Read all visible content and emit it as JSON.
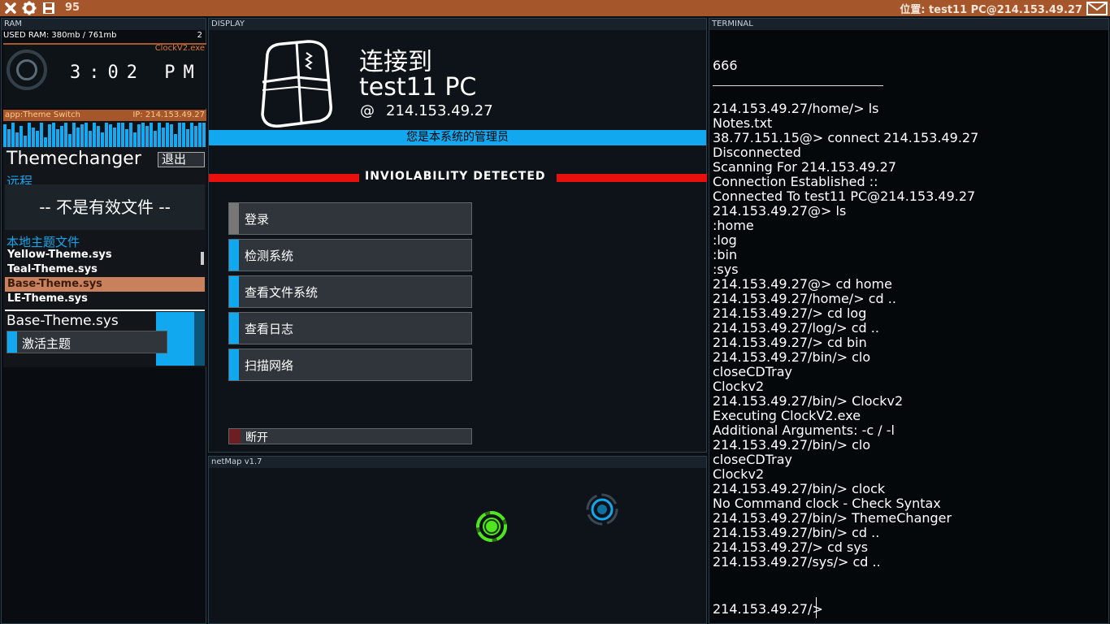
{
  "topbar": {
    "credits": "95",
    "location": "位置: test11 PC@214.153.49.27",
    "icons": [
      "close-icon",
      "gear-icon",
      "save-icon",
      "mail-icon"
    ],
    "color": "#a5562a"
  },
  "ram": {
    "title": "RAM",
    "used": "USED RAM: 380mb / 761mb",
    "count": "2",
    "clock": {
      "exe": "ClockV2.exe",
      "time": "3:02 PM"
    },
    "theme": {
      "app": "app:Theme Switch",
      "ip": "IP: 214.153.49.27",
      "title": "Themechanger",
      "exit": "退出",
      "remote": "远程",
      "invalid": "-- 不是有效文件 --",
      "local_header": "本地主题文件",
      "files": [
        "Yellow-Theme.sys",
        "Teal-Theme.sys",
        "Base-Theme.sys",
        "LE-Theme.sys"
      ],
      "selected_index": 2,
      "current": "Base-Theme.sys",
      "activate": "激活主题"
    }
  },
  "display": {
    "title": "DISPLAY",
    "connect_line1": "连接到",
    "connect_line2": "test11 PC",
    "at": "@",
    "ip": "214.153.49.27",
    "admin": "您是本系统的管理员",
    "inviolability": "INVIOLABILITY DETECTED",
    "buttons": [
      "登录",
      "检测系统",
      "查看文件系统",
      "查看日志",
      "扫描网络"
    ],
    "disconnect": "断开"
  },
  "netmap": {
    "title": "netMap v1.7",
    "nodes": [
      {
        "name": "home-node",
        "color": "#4ee61e"
      },
      {
        "name": "remote-node",
        "color": "#12a8ef"
      }
    ]
  },
  "terminal": {
    "title": "TERMINAL",
    "header": "666",
    "lines": [
      "214.153.49.27/home/> ls",
      "Notes.txt",
      "38.77.151.15@> connect 214.153.49.27",
      "Disconnected",
      "Scanning For 214.153.49.27",
      "Connection Established ::",
      "Connected To test11 PC@214.153.49.27",
      "214.153.49.27@> ls",
      ":home",
      ":log",
      ":bin",
      ":sys",
      "214.153.49.27@> cd home",
      "214.153.49.27/home/> cd ..",
      "214.153.49.27/> cd log",
      "214.153.49.27/log/> cd ..",
      "214.153.49.27/> cd bin",
      "214.153.49.27/bin/> clo",
      "closeCDTray",
      "Clockv2",
      "214.153.49.27/bin/> Clockv2",
      "Executing ClockV2.exe",
      "Additional Arguments: -c / -l",
      "214.153.49.27/bin/> clo",
      "closeCDTray",
      "Clockv2",
      "214.153.49.27/bin/> clock",
      "No Command clock - Check Syntax",
      "214.153.49.27/bin/> ThemeChanger",
      "214.153.49.27/bin/> cd ..",
      "214.153.49.27/> cd sys",
      "214.153.49.27/sys/> cd .."
    ],
    "prompt": "214.153.49.27/>"
  }
}
